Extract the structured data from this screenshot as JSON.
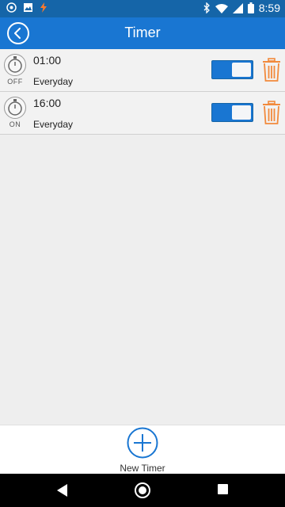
{
  "status_bar": {
    "time": "8:59",
    "icons_left": [
      "chrome-icon",
      "image-icon",
      "flash-icon"
    ],
    "icons_right": [
      "bluetooth-icon",
      "wifi-icon",
      "signal-icon",
      "battery-icon"
    ]
  },
  "app_bar": {
    "title": "Timer",
    "back_icon": "chevron-left-icon"
  },
  "timers": [
    {
      "time": "01:00",
      "repeat": "Everyday",
      "state": "OFF",
      "enabled": true
    },
    {
      "time": "16:00",
      "repeat": "Everyday",
      "state": "ON",
      "enabled": true
    }
  ],
  "bottom_bar": {
    "add_label": "New Timer"
  },
  "colors": {
    "primary": "#1976d2",
    "status_bar": "#1565a8",
    "delete": "#f28a3c",
    "background": "#eeeeee"
  }
}
